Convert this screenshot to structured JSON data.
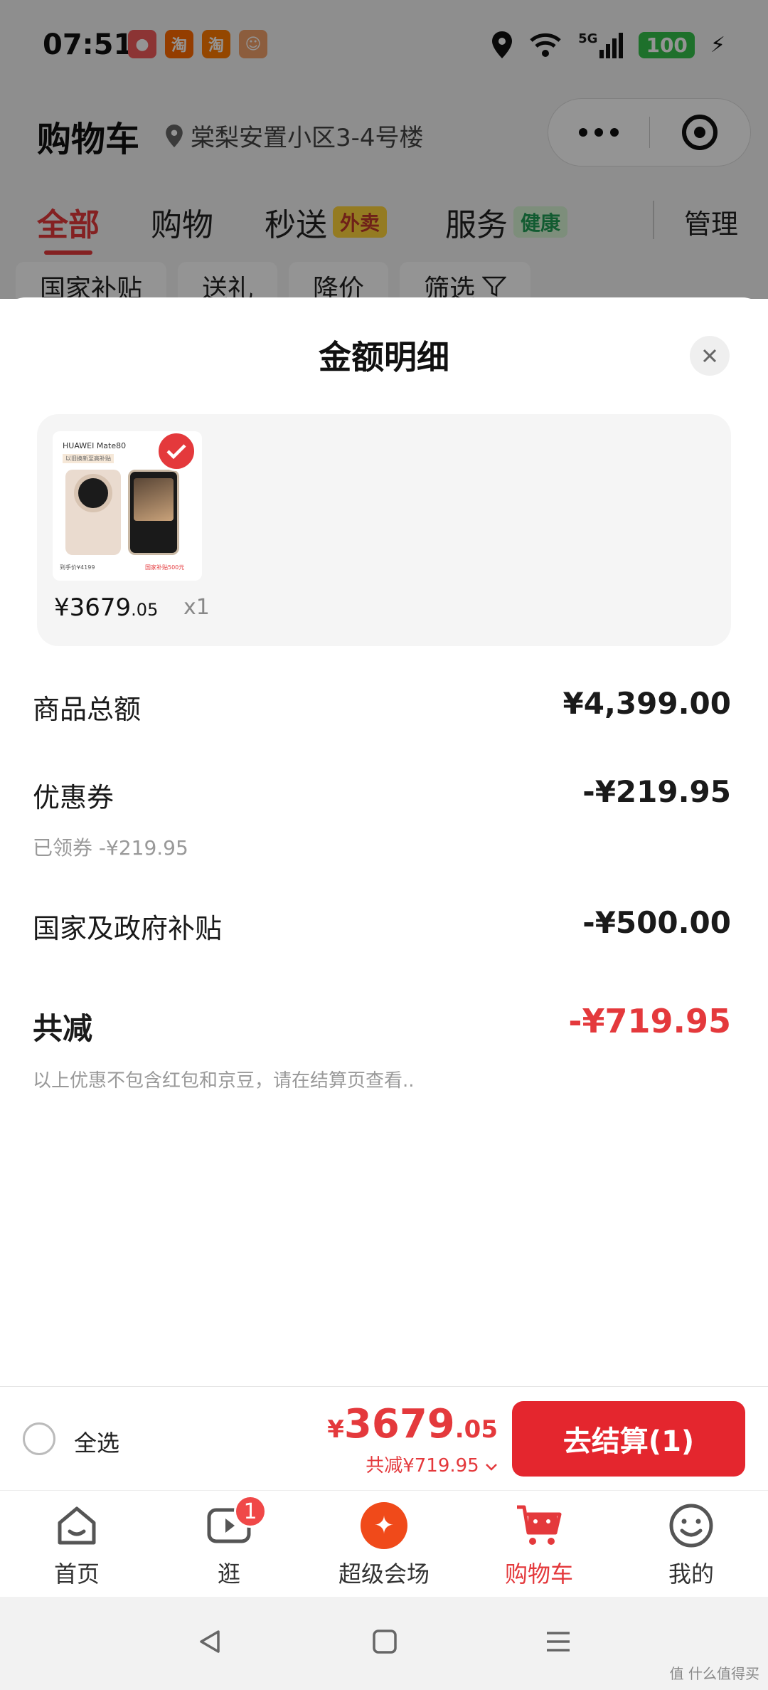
{
  "status_bar": {
    "time": "07:51",
    "network": "5G",
    "battery": "100",
    "app_icons": [
      "淘",
      "淘"
    ]
  },
  "header": {
    "title": "购物车",
    "location": "棠梨安置小区3-4号楼"
  },
  "tabs": [
    {
      "label": "全部"
    },
    {
      "label": "购物"
    },
    {
      "label": "秒送",
      "tag": "外卖"
    },
    {
      "label": "服务",
      "tag": "健康"
    }
  ],
  "manage_label": "管理",
  "filters": [
    "国家补贴",
    "送礼",
    "降价",
    "筛选"
  ],
  "sheet": {
    "title": "金额明细",
    "product": {
      "thumb_caption": "HUAWEI Mate80",
      "thumb_sub": "以旧换新至高补贴",
      "thumb_foot_left": "到手价¥4199",
      "thumb_foot_right": "国家补贴500元",
      "price_int": "¥3679",
      "price_dec": ".05",
      "quantity": "x1"
    },
    "rows": {
      "goods_total_label": "商品总额",
      "goods_total_value": "¥4,399.00",
      "coupon_label": "优惠券",
      "coupon_value": "-¥219.95",
      "coupon_sub": "已领券 -¥219.95",
      "subsidy_label": "国家及政府补贴",
      "subsidy_value": "-¥500.00",
      "total_reduce_label": "共减",
      "total_reduce_value": "-¥719.95",
      "note": "以上优惠不包含红包和京豆，请在结算页查看.."
    }
  },
  "checkout": {
    "select_all": "全选",
    "yen": "¥",
    "price_int": "3679",
    "price_dec": ".05",
    "discount": "共减¥719.95",
    "button": "去结算(1)"
  },
  "bottom_nav": [
    {
      "label": "首页"
    },
    {
      "label": "逛",
      "badge": "1"
    },
    {
      "label": "超级会场"
    },
    {
      "label": "购物车"
    },
    {
      "label": "我的"
    }
  ],
  "watermark": "值 什么值得买",
  "colors": {
    "accent": "#e4393c",
    "checkout_button": "#e4262e",
    "battery": "#35c14a"
  }
}
